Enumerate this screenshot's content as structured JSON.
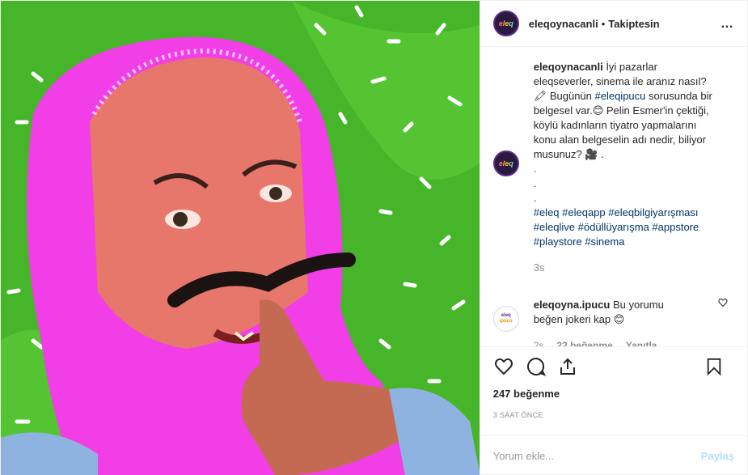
{
  "post": {
    "username": "eleqoynacanli",
    "separator": "•",
    "follow_status": "Takiptesin",
    "more_icon": "…",
    "avatar_text": "eleq"
  },
  "caption": {
    "username": "eleqoynacanli",
    "text_1": " İyi pazarlar eleqseverler, sinema ile aranız nasıl? 🖍 Bugünün ",
    "tag_1": "#eleqipucu",
    "text_2": " sorusunda bir belgesel var.😊 Pelin Esmer'in çektiği, köylü kadınların tiyatro yapmalarını konu alan belgeselin adı nedir, biliyor musunuz? 🎥 .",
    "dot_1": ".",
    "dot_2": ".",
    "dot_3": ".",
    "hashtags": "#eleq #eleqapp #eleqbilgiyarışması #eleqlive #ödüllüyarışma #appstore #playstore #sinema",
    "time": "3s"
  },
  "reply": {
    "username": "eleqoyna.ipucu",
    "text": " Bu yorumu beğen jokeri kap 😊",
    "time": "2s",
    "likes": "22 beğenme",
    "reply_label": "Yanıtla",
    "avatar_top": "eleq",
    "avatar_bottom": "ipucu"
  },
  "actions": {
    "likes": "247 beğenme",
    "ago": "3 SAAT ÖNCE"
  },
  "comment_box": {
    "placeholder": "Yorum ekle...",
    "post_label": "Paylaş"
  },
  "colors": {
    "hashtag": "#003569",
    "muted": "#8e8e8e",
    "post_disabled": "#b2dffc",
    "media_bg": "#46b52a",
    "headscarf": "#f23ee6"
  }
}
